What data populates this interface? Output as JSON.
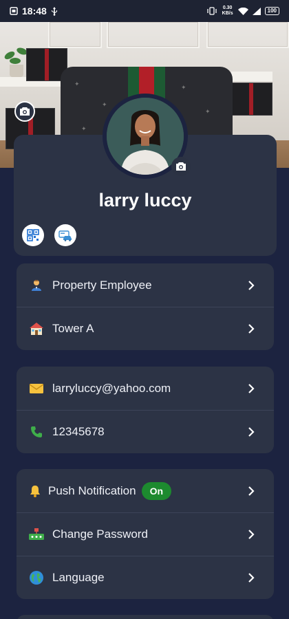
{
  "status_bar": {
    "time": "18:48",
    "network_speed": "0.30 KB/s",
    "battery": "100"
  },
  "profile": {
    "name": "larry luccy"
  },
  "role_section": {
    "items": [
      {
        "label": "Property Employee",
        "icon": "employee-icon"
      },
      {
        "label": "Tower A",
        "icon": "building-icon"
      }
    ]
  },
  "contact_section": {
    "items": [
      {
        "label": "larryluccy@yahoo.com",
        "icon": "mail-icon"
      },
      {
        "label": "12345678",
        "icon": "phone-icon"
      }
    ]
  },
  "settings_section": {
    "items": [
      {
        "label": "Push Notification",
        "icon": "bell-icon",
        "badge": "On"
      },
      {
        "label": "Change Password",
        "icon": "password-icon"
      },
      {
        "label": "Language",
        "icon": "globe-icon"
      }
    ]
  },
  "colors": {
    "background": "#1c2340",
    "card": "#2c3345",
    "badge_on": "#1d8a2f"
  }
}
